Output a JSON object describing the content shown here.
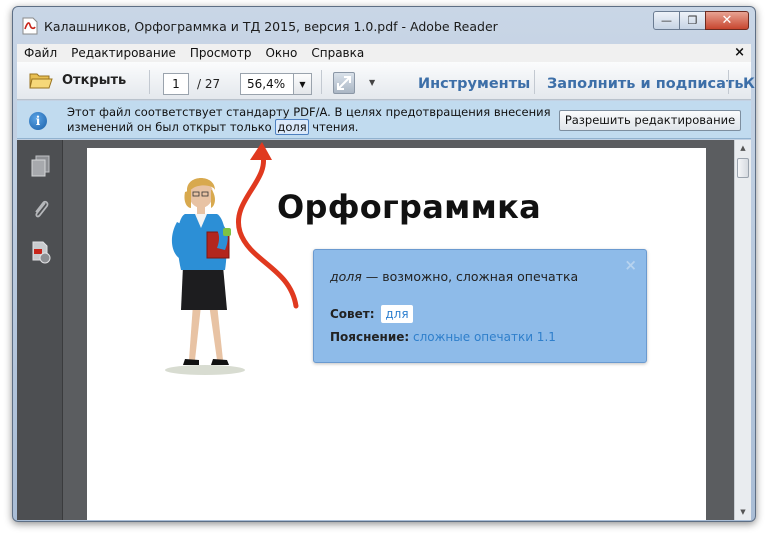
{
  "window": {
    "title": "Калашников, Орфограммка и ТД 2015, версия 1.0.pdf - Adobe Reader",
    "minimize": "—",
    "maximize": "❐",
    "close": "✕"
  },
  "menu": {
    "items": [
      "Файл",
      "Редактирование",
      "Просмотр",
      "Окно",
      "Справка"
    ],
    "close": "×"
  },
  "toolbar": {
    "open_label": "Открыть",
    "page_current": "1",
    "page_total": "/ 27",
    "zoom": "56,4%",
    "tools_label": "Инструменты",
    "fill_sign_label": "Заполнить и подписать",
    "comment_label": "Ко"
  },
  "infobar": {
    "line1": "Этот файл соответствует стандарту PDF/A. В целях предотвращения внесения",
    "line2_before": "изменений он был открыт только",
    "line2_highlight": "доля",
    "line2_after": "чтения.",
    "allow_button": "Разрешить редактирование"
  },
  "document": {
    "heading": "Орфограммка"
  },
  "tooltip": {
    "word": "доля",
    "message": "— возможно, сложная опечатка",
    "advice_label": "Совет:",
    "advice_value": "для",
    "explain_label": "Пояснение:",
    "explain_link": "сложные опечатки 1.1",
    "close": "×"
  },
  "colors": {
    "accent_link": "#3d6fa8",
    "infobar_bg": "#c1dbef",
    "tooltip_bg": "#8ebbe9",
    "arrow": "#e0391f"
  }
}
